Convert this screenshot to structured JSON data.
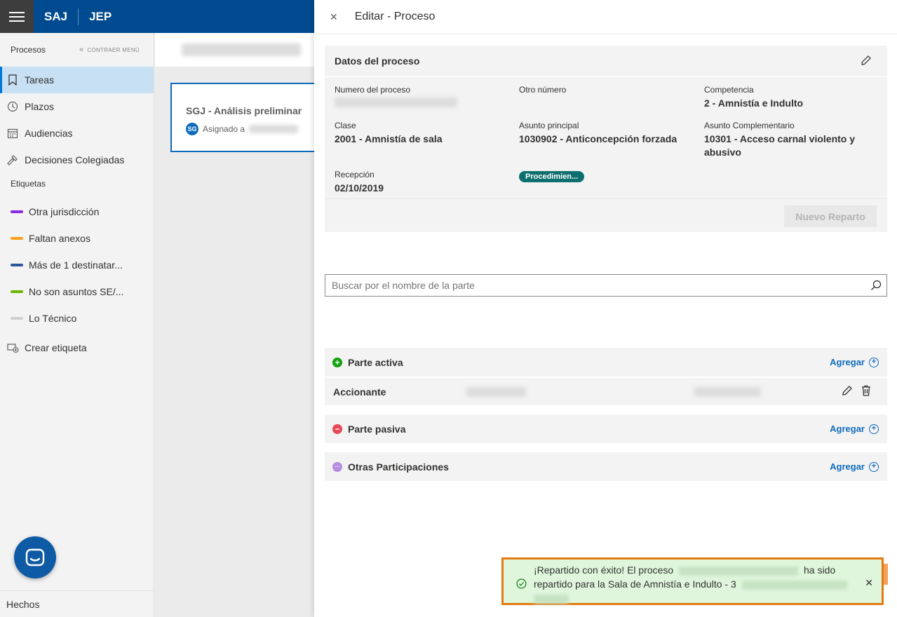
{
  "topbar": {
    "brand1": "SAJ",
    "brand2": "JEP"
  },
  "sidebar": {
    "header": "Procesos",
    "collapse_label": "CONTRAER MENÚ",
    "items": [
      {
        "label": "Tareas",
        "icon": "bookmark-icon",
        "active": true
      },
      {
        "label": "Plazos",
        "icon": "clock-icon"
      },
      {
        "label": "Audiencias",
        "icon": "calendar-icon"
      },
      {
        "label": "Decisiones Colegiadas",
        "icon": "gavel-icon"
      }
    ],
    "tags_header": "Etiquetas",
    "tags": [
      {
        "label": "Otra jurisdicción",
        "color": "#8a2be2"
      },
      {
        "label": "Faltan anexos",
        "color": "#f7a11a"
      },
      {
        "label": "Más de 1 destinatar...",
        "color": "#2b579a"
      },
      {
        "label": "No son asuntos SE/...",
        "color": "#6bb700"
      },
      {
        "label": "Lo Técnico",
        "color": "#d2d0ce"
      }
    ],
    "create_tag": "Crear etiqueta",
    "footer": "Hechos"
  },
  "task": {
    "title": "SGJ - Análisis preliminar",
    "avatar": "SG",
    "assigned_prefix": "Asignado a"
  },
  "panel": {
    "close": "✕",
    "title": "Editar - Proceso",
    "datos_title": "Datos del proceso",
    "fields": {
      "numero": {
        "label": "Numero del proceso"
      },
      "otro": {
        "label": "Otro número"
      },
      "competencia": {
        "label": "Competencia",
        "value": "2 - Amnistía e Indulto"
      },
      "clase": {
        "label": "Clase",
        "value": "2001 - Amnistía de sala"
      },
      "asunto": {
        "label": "Asunto principal",
        "value": "1030902 - Anticoncepción forzada"
      },
      "complementario": {
        "label": "Asunto Complementario",
        "value": "10301 - Acceso carnal violento y abusivo"
      },
      "recepcion": {
        "label": "Recepción",
        "value": "02/10/2019"
      }
    },
    "badge": "Procedimien...",
    "nuevo_reparto": "Nuevo Reparto",
    "search_placeholder": "Buscar por el nombre de la parte",
    "groups": {
      "activa": {
        "label": "Parte activa",
        "color": "#13a10e",
        "symbol": "+"
      },
      "pasiva": {
        "label": "Parte pasiva",
        "color": "#e74856",
        "symbol": "−"
      },
      "otras": {
        "label": "Otras Participaciones",
        "color": "#b68be0",
        "symbol": "···"
      }
    },
    "agregar": "Agregar",
    "row_role": "Accionante"
  },
  "toast": {
    "line1_a": "¡Repartido con éxito! El proceso",
    "line1_b": "ha sido",
    "line2": "repartido para la Sala de Amnistía e Indulto - 3"
  }
}
